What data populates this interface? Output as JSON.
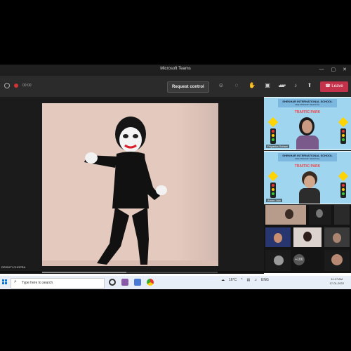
{
  "window": {
    "title": "Microsoft Teams",
    "controls": [
      "—",
      "▢",
      "✕"
    ]
  },
  "toolbar": {
    "elapsed": "00:00",
    "request_control_label": "Request control",
    "leave_label": "Leave",
    "icons": [
      "people-icon",
      "chat-icon",
      "react-icon",
      "breakout-icon",
      "more-icon",
      "camera-icon",
      "mic-icon",
      "share-icon"
    ]
  },
  "stage": {
    "presenter_name": "DRISHTI CHOPRA"
  },
  "side_panel": {
    "tile1": {
      "school": "SHEKHAR INTERNATIONAL SCHOOL",
      "subtitle": "PRE PRIMARY FESTIVAL",
      "theme": "TRAFFIC PARK",
      "name": "Priyanka Sahani"
    },
    "tile2": {
      "school": "SHEKHAR INTERNATIONAL SCHOOL",
      "subtitle": "PRE PRIMARY FESTIVAL",
      "theme": "TRAFFIC PARK",
      "name": "Arnav Jain"
    },
    "more_count": "+100"
  },
  "taskbar": {
    "search_placeholder": "Type here to search",
    "weather": "16°C",
    "lang": "ENG",
    "time": "11:17 AM",
    "date": "17-01-2022"
  },
  "colors": {
    "leave": "#c4314b",
    "accent": "#0a74d6"
  }
}
